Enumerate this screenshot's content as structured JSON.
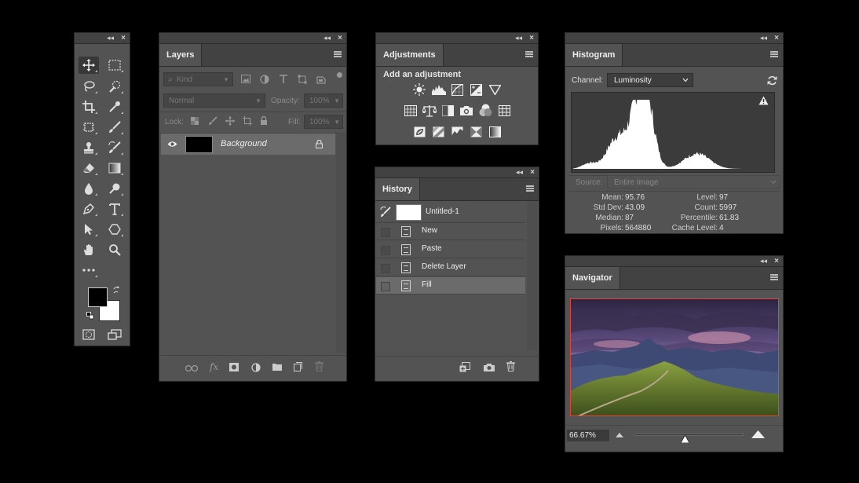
{
  "layers": {
    "tab": "Layers",
    "kind": "Kind",
    "blend_mode": "Normal",
    "opacity_label": "Opacity:",
    "opacity_value": "100%",
    "lock_label": "Lock:",
    "fill_label": "Fill:",
    "fill_value": "100%",
    "layer_name": "Background"
  },
  "adjustments": {
    "tab": "Adjustments",
    "heading": "Add an adjustment"
  },
  "history": {
    "tab": "History",
    "snapshot": "Untitled-1",
    "items": [
      "New",
      "Paste",
      "Delete Layer",
      "Fill"
    ]
  },
  "histogram": {
    "tab": "Histogram",
    "channel_label": "Channel:",
    "channel_value": "Luminosity",
    "source_label": "Source:",
    "source_value": "Entire Image",
    "stats_left": [
      {
        "k": "Mean:",
        "v": "95.76"
      },
      {
        "k": "Std Dev:",
        "v": "43.09"
      },
      {
        "k": "Median:",
        "v": "87"
      },
      {
        "k": "Pixels:",
        "v": "564880"
      }
    ],
    "stats_right": [
      {
        "k": "Level:",
        "v": "97"
      },
      {
        "k": "Count:",
        "v": "5997"
      },
      {
        "k": "Percentile:",
        "v": "61.83"
      },
      {
        "k": "Cache Level:",
        "v": "4"
      }
    ]
  },
  "navigator": {
    "tab": "Navigator",
    "zoom": "66.67%",
    "zoom_slider_fraction": 0.46,
    "proxy_color": "#e0443a"
  }
}
